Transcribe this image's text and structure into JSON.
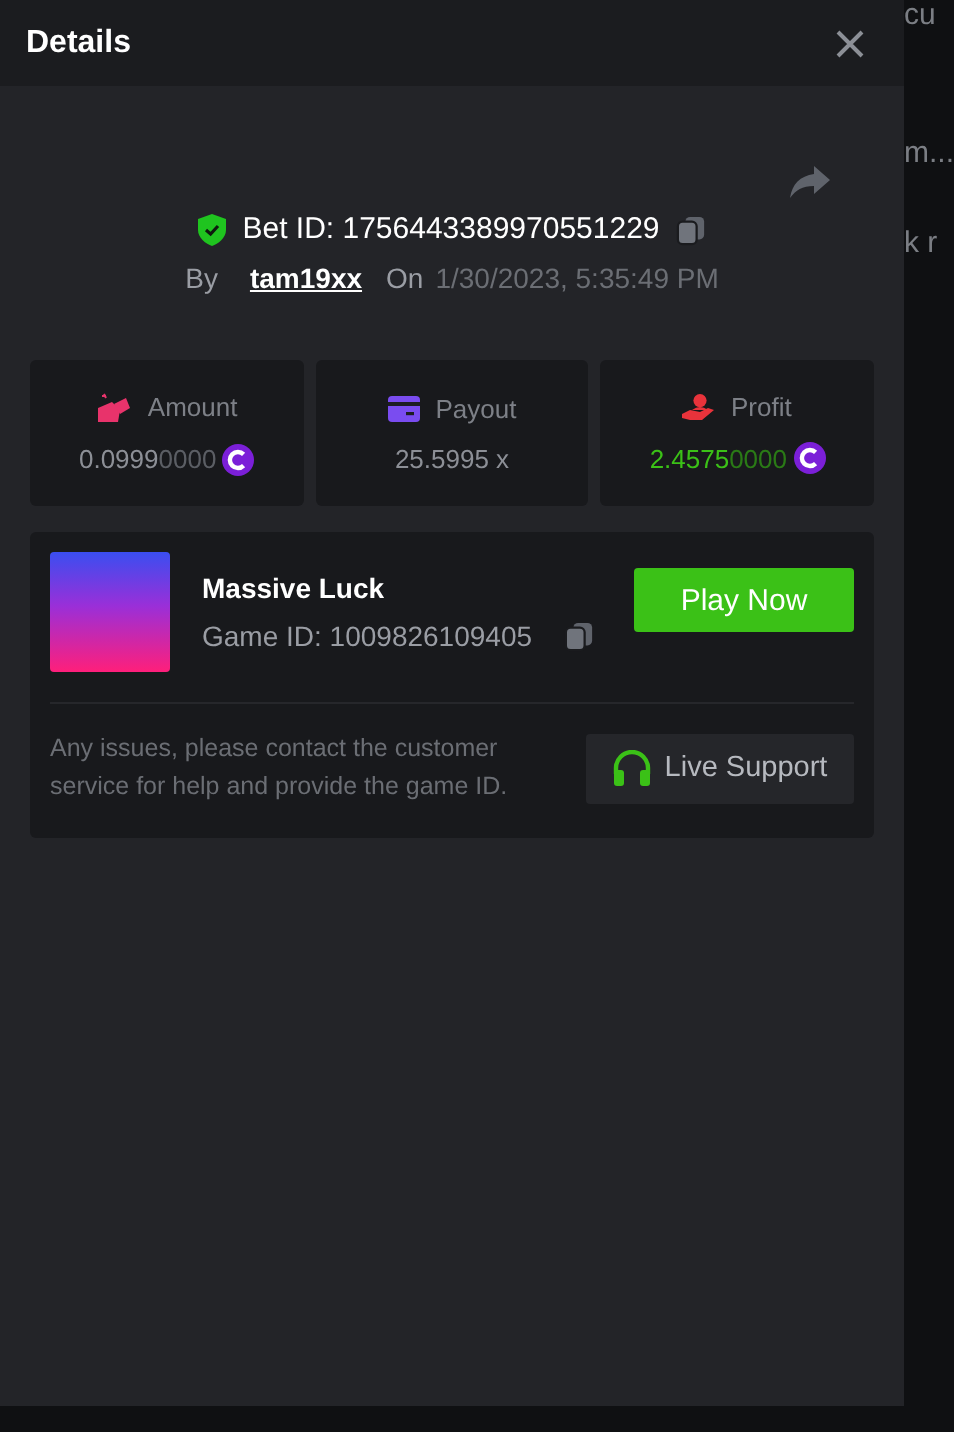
{
  "header": {
    "title": "Details"
  },
  "backdrop_texts": [
    "cu",
    "m...",
    "k r"
  ],
  "bet": {
    "id_text": "Bet ID: 1756443389970551229",
    "by_label": "By",
    "user": "tam19xx",
    "on_label": "On",
    "date": "1/30/2023, 5:35:49 PM"
  },
  "stats": [
    {
      "kind": "amount",
      "label": "Amount",
      "value": "0.0999",
      "value_pad": "0000",
      "coin": true
    },
    {
      "kind": "payout",
      "label": "Payout",
      "value": "25.5995 x"
    },
    {
      "kind": "profit",
      "label": "Profit",
      "value": "2.4575",
      "value_pad": "0000",
      "coin": true
    }
  ],
  "game": {
    "name": "Massive Luck",
    "id_text": "Game ID: 1009826109405",
    "play_button": "Play Now",
    "note": "Any issues, please contact the customer service for help and provide the game ID.",
    "support_button": "Live Support"
  }
}
